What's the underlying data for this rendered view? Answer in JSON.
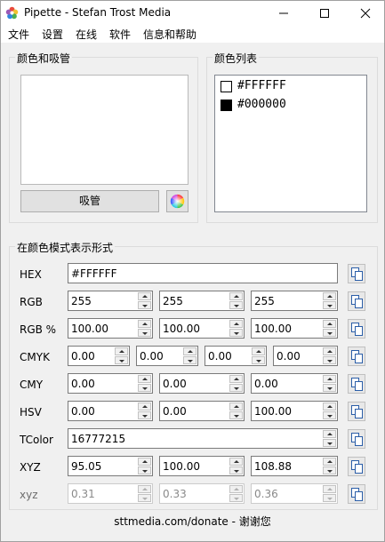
{
  "window": {
    "title": "Pipette - Stefan Trost Media"
  },
  "menu": [
    "文件",
    "设置",
    "在线",
    "软件",
    "信息和帮助"
  ],
  "picker": {
    "group_label": "颜色和吸管",
    "pipette_button": "吸管"
  },
  "color_list": {
    "group_label": "颜色列表",
    "items": [
      {
        "hex": "#FFFFFF",
        "swatch": "#FFFFFF"
      },
      {
        "hex": "#000000",
        "swatch": "#000000"
      }
    ]
  },
  "modes": {
    "group_label": "在颜色模式表示形式",
    "rows": [
      {
        "label": "HEX",
        "values": [
          "#FFFFFF"
        ]
      },
      {
        "label": "RGB",
        "values": [
          "255",
          "255",
          "255"
        ]
      },
      {
        "label": "RGB %",
        "values": [
          "100.00",
          "100.00",
          "100.00"
        ]
      },
      {
        "label": "CMYK",
        "values": [
          "0.00",
          "0.00",
          "0.00",
          "0.00"
        ]
      },
      {
        "label": "CMY",
        "values": [
          "0.00",
          "0.00",
          "0.00"
        ]
      },
      {
        "label": "HSV",
        "values": [
          "0.00",
          "0.00",
          "100.00"
        ]
      },
      {
        "label": "TColor",
        "values": [
          "16777215"
        ]
      },
      {
        "label": "XYZ",
        "values": [
          "95.05",
          "100.00",
          "108.88"
        ]
      },
      {
        "label": "xyz",
        "values": [
          "0.31",
          "0.33",
          "0.36"
        ],
        "disabled": true
      }
    ]
  },
  "footer": "sttmedia.com/donate - 谢谢您",
  "colors": {
    "accent_swatch_white": "#FFFFFF",
    "accent_swatch_black": "#000000"
  }
}
